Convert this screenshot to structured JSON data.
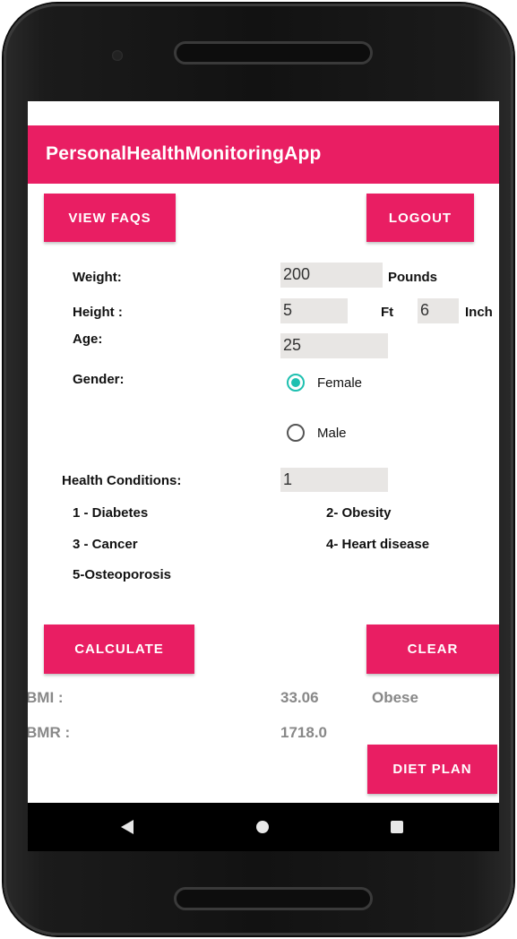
{
  "app": {
    "title": "PersonalHealthMonitoringApp"
  },
  "buttons": {
    "view_faqs": "VIEW FAQS",
    "logout": "LOGOUT",
    "calculate": "CALCULATE",
    "clear": "CLEAR",
    "diet_plan": "DIET PLAN"
  },
  "form": {
    "weight_label": "Weight:",
    "weight_value": "200",
    "weight_unit": "Pounds",
    "height_label": "Height :",
    "height_ft_value": "5",
    "height_ft_unit": "Ft",
    "height_in_value": "6",
    "height_in_unit": "Inch",
    "age_label": "Age:",
    "age_value": "25",
    "gender_label": "Gender:",
    "gender_options": [
      {
        "label": "Female",
        "selected": true
      },
      {
        "label": "Male",
        "selected": false
      }
    ],
    "health_label": "Health Conditions:",
    "health_value": "1"
  },
  "conditions": {
    "c1": "1 - Diabetes",
    "c2": "2- Obesity",
    "c3": "3 - Cancer",
    "c4": "4- Heart disease",
    "c5": "5-Osteoporosis"
  },
  "results": {
    "bmi_label": "BMI :",
    "bmi_value": "33.06",
    "bmi_category": "Obese",
    "bmr_label": "BMR :",
    "bmr_value": "1718.0"
  },
  "colors": {
    "accent": "#e91e63",
    "radio": "#1ec0b0",
    "field_bg": "#e8e6e4"
  },
  "icons": {
    "nav_back": "back-triangle-icon",
    "nav_home": "home-circle-icon",
    "nav_recent": "recent-square-icon"
  }
}
